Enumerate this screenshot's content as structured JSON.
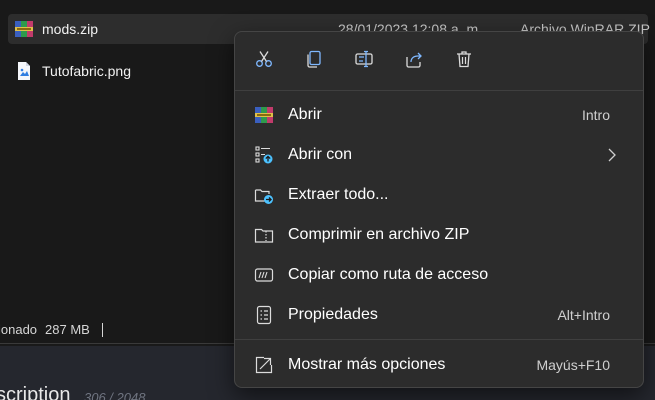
{
  "explorer": {
    "files": [
      {
        "name": "mods.zip",
        "date": "28/01/2023 12:08 a. m.",
        "type": "Archivo WinRAR ZIP",
        "icon": "winrar-archive-icon"
      },
      {
        "name": "Tutofabric.png",
        "icon": "image-file-icon"
      }
    ],
    "status": {
      "selected_text": "ionado",
      "size": "287 MB"
    },
    "below": {
      "description": "scription",
      "counter": "306 / 2048"
    }
  },
  "context_menu": {
    "quick_actions": [
      {
        "name": "cut-icon",
        "tooltip": "Cortar"
      },
      {
        "name": "copy-icon",
        "tooltip": "Copiar"
      },
      {
        "name": "rename-icon",
        "tooltip": "Cambiar nombre"
      },
      {
        "name": "share-icon",
        "tooltip": "Compartir"
      },
      {
        "name": "delete-icon",
        "tooltip": "Eliminar"
      }
    ],
    "items": [
      {
        "label": "Abrir",
        "shortcut": "Intro",
        "icon": "winrar-icon"
      },
      {
        "label": "Abrir con",
        "shortcut": "",
        "icon": "open-with-icon",
        "submenu": true
      },
      {
        "label": "Extraer todo...",
        "shortcut": "",
        "icon": "extract-folder-icon"
      },
      {
        "label": "Comprimir en archivo ZIP",
        "shortcut": "",
        "icon": "zip-folder-icon"
      },
      {
        "label": "Copiar como ruta de acceso",
        "shortcut": "",
        "icon": "copy-path-icon"
      },
      {
        "label": "Propiedades",
        "shortcut": "Alt+Intro",
        "icon": "properties-icon"
      },
      {
        "label": "Mostrar más opciones",
        "shortcut": "Mayús+F10",
        "icon": "more-options-icon"
      }
    ]
  },
  "colors": {
    "accent": "#4cc2ff",
    "menu_bg": "#2c2c2c",
    "selection": "#2d2d2d"
  }
}
